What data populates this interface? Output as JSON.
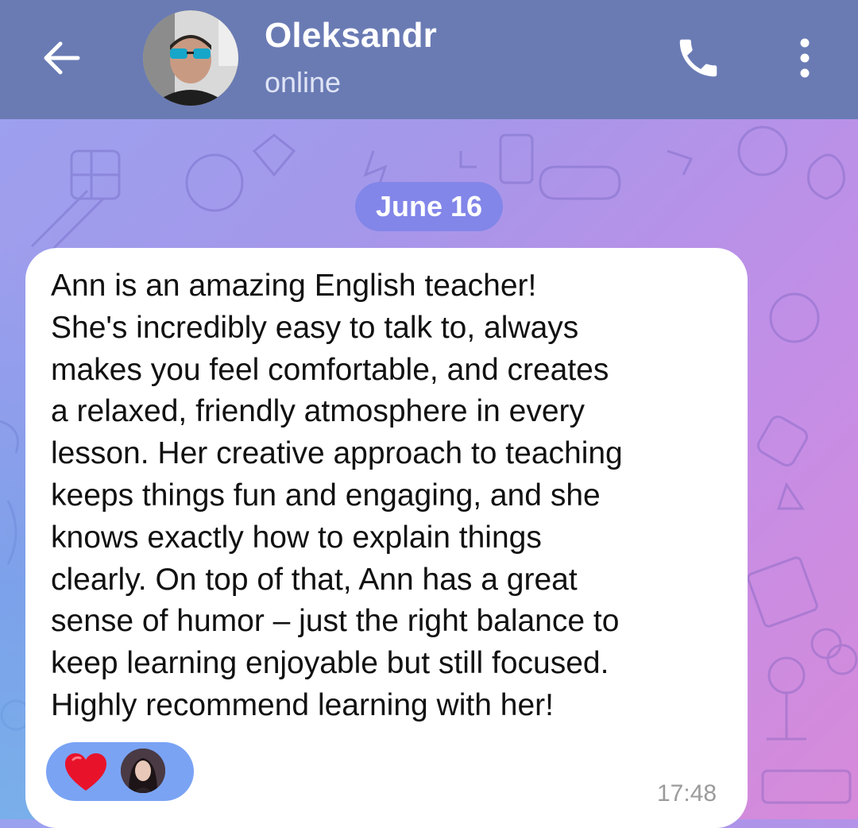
{
  "header": {
    "contact_name": "Oleksandr",
    "status": "online",
    "icons": [
      "arrow-left-icon",
      "phone-icon",
      "more-vertical-icon"
    ]
  },
  "chat": {
    "date_label": "June 16",
    "message": {
      "text": "Ann is an amazing English teacher!\nShe's incredibly easy to talk to, always\nmakes you feel comfortable, and creates\na relaxed, friendly atmosphere in every\nlesson. Her creative approach to teaching\nkeeps things fun and engaging, and she\nknows exactly how to explain things\nclearly. On top of that, Ann has a great\nsense of humor – just the right balance to\nkeep learning enjoyable but still focused.\nHighly recommend learning with her!",
      "time": "17:48",
      "reaction": {
        "emoji": "heart-icon",
        "reactor": "reactor-avatar"
      }
    }
  },
  "colors": {
    "header_bg": "#6a7bb4",
    "date_chip_bg": "#8286e9",
    "reaction_bg": "#7aa3f4",
    "heart": "#e8132b",
    "bubble_bg": "#ffffff"
  }
}
